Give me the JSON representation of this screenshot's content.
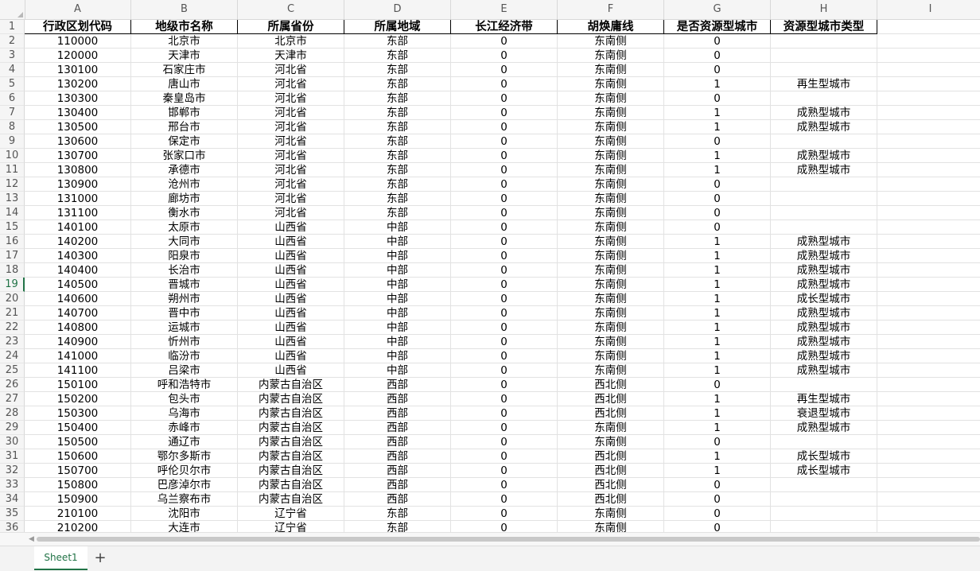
{
  "columns": [
    "A",
    "B",
    "C",
    "D",
    "E",
    "F",
    "G",
    "H",
    "I"
  ],
  "header_cells": [
    "行政区划代码",
    "地级市名称",
    "所属省份",
    "所属地域",
    "长江经济带",
    "胡焕庸线",
    "是否资源型城市",
    "资源型城市类型"
  ],
  "rows": [
    [
      "110000",
      "北京市",
      "北京市",
      "东部",
      "0",
      "东南侧",
      "0",
      ""
    ],
    [
      "120000",
      "天津市",
      "天津市",
      "东部",
      "0",
      "东南侧",
      "0",
      ""
    ],
    [
      "130100",
      "石家庄市",
      "河北省",
      "东部",
      "0",
      "东南侧",
      "0",
      ""
    ],
    [
      "130200",
      "唐山市",
      "河北省",
      "东部",
      "0",
      "东南侧",
      "1",
      "再生型城市"
    ],
    [
      "130300",
      "秦皇岛市",
      "河北省",
      "东部",
      "0",
      "东南侧",
      "0",
      ""
    ],
    [
      "130400",
      "邯郸市",
      "河北省",
      "东部",
      "0",
      "东南侧",
      "1",
      "成熟型城市"
    ],
    [
      "130500",
      "邢台市",
      "河北省",
      "东部",
      "0",
      "东南侧",
      "1",
      "成熟型城市"
    ],
    [
      "130600",
      "保定市",
      "河北省",
      "东部",
      "0",
      "东南侧",
      "0",
      ""
    ],
    [
      "130700",
      "张家口市",
      "河北省",
      "东部",
      "0",
      "东南侧",
      "1",
      "成熟型城市"
    ],
    [
      "130800",
      "承德市",
      "河北省",
      "东部",
      "0",
      "东南侧",
      "1",
      "成熟型城市"
    ],
    [
      "130900",
      "沧州市",
      "河北省",
      "东部",
      "0",
      "东南侧",
      "0",
      ""
    ],
    [
      "131000",
      "廊坊市",
      "河北省",
      "东部",
      "0",
      "东南侧",
      "0",
      ""
    ],
    [
      "131100",
      "衡水市",
      "河北省",
      "东部",
      "0",
      "东南侧",
      "0",
      ""
    ],
    [
      "140100",
      "太原市",
      "山西省",
      "中部",
      "0",
      "东南侧",
      "0",
      ""
    ],
    [
      "140200",
      "大同市",
      "山西省",
      "中部",
      "0",
      "东南侧",
      "1",
      "成熟型城市"
    ],
    [
      "140300",
      "阳泉市",
      "山西省",
      "中部",
      "0",
      "东南侧",
      "1",
      "成熟型城市"
    ],
    [
      "140400",
      "长治市",
      "山西省",
      "中部",
      "0",
      "东南侧",
      "1",
      "成熟型城市"
    ],
    [
      "140500",
      "晋城市",
      "山西省",
      "中部",
      "0",
      "东南侧",
      "1",
      "成熟型城市"
    ],
    [
      "140600",
      "朔州市",
      "山西省",
      "中部",
      "0",
      "东南侧",
      "1",
      "成长型城市"
    ],
    [
      "140700",
      "晋中市",
      "山西省",
      "中部",
      "0",
      "东南侧",
      "1",
      "成熟型城市"
    ],
    [
      "140800",
      "运城市",
      "山西省",
      "中部",
      "0",
      "东南侧",
      "1",
      "成熟型城市"
    ],
    [
      "140900",
      "忻州市",
      "山西省",
      "中部",
      "0",
      "东南侧",
      "1",
      "成熟型城市"
    ],
    [
      "141000",
      "临汾市",
      "山西省",
      "中部",
      "0",
      "东南侧",
      "1",
      "成熟型城市"
    ],
    [
      "141100",
      "吕梁市",
      "山西省",
      "中部",
      "0",
      "东南侧",
      "1",
      "成熟型城市"
    ],
    [
      "150100",
      "呼和浩特市",
      "内蒙古自治区",
      "西部",
      "0",
      "西北侧",
      "0",
      ""
    ],
    [
      "150200",
      "包头市",
      "内蒙古自治区",
      "西部",
      "0",
      "西北侧",
      "1",
      "再生型城市"
    ],
    [
      "150300",
      "乌海市",
      "内蒙古自治区",
      "西部",
      "0",
      "西北侧",
      "1",
      "衰退型城市"
    ],
    [
      "150400",
      "赤峰市",
      "内蒙古自治区",
      "西部",
      "0",
      "东南侧",
      "1",
      "成熟型城市"
    ],
    [
      "150500",
      "通辽市",
      "内蒙古自治区",
      "西部",
      "0",
      "东南侧",
      "0",
      ""
    ],
    [
      "150600",
      "鄂尔多斯市",
      "内蒙古自治区",
      "西部",
      "0",
      "西北侧",
      "1",
      "成长型城市"
    ],
    [
      "150700",
      "呼伦贝尔市",
      "内蒙古自治区",
      "西部",
      "0",
      "西北侧",
      "1",
      "成长型城市"
    ],
    [
      "150800",
      "巴彦淖尔市",
      "内蒙古自治区",
      "西部",
      "0",
      "西北侧",
      "0",
      ""
    ],
    [
      "150900",
      "乌兰察布市",
      "内蒙古自治区",
      "西部",
      "0",
      "西北侧",
      "0",
      ""
    ],
    [
      "210100",
      "沈阳市",
      "辽宁省",
      "东部",
      "0",
      "东南侧",
      "0",
      ""
    ],
    [
      "210200",
      "大连市",
      "辽宁省",
      "东部",
      "0",
      "东南侧",
      "0",
      ""
    ]
  ],
  "row_numbers": [
    "1",
    "2",
    "3",
    "4",
    "5",
    "6",
    "7",
    "8",
    "9",
    "10",
    "11",
    "12",
    "13",
    "14",
    "15",
    "16",
    "17",
    "18",
    "19",
    "20",
    "21",
    "22",
    "23",
    "24",
    "25",
    "26",
    "27",
    "28",
    "29",
    "30",
    "31",
    "32",
    "33",
    "34",
    "35",
    "36"
  ],
  "active_row": "19",
  "sheet_tabs": [
    "Sheet1"
  ],
  "add_sheet_label": "+",
  "colors": {
    "accent": "#217346",
    "grid": "#e2e2e2",
    "header_bg": "#f5f5f5"
  }
}
